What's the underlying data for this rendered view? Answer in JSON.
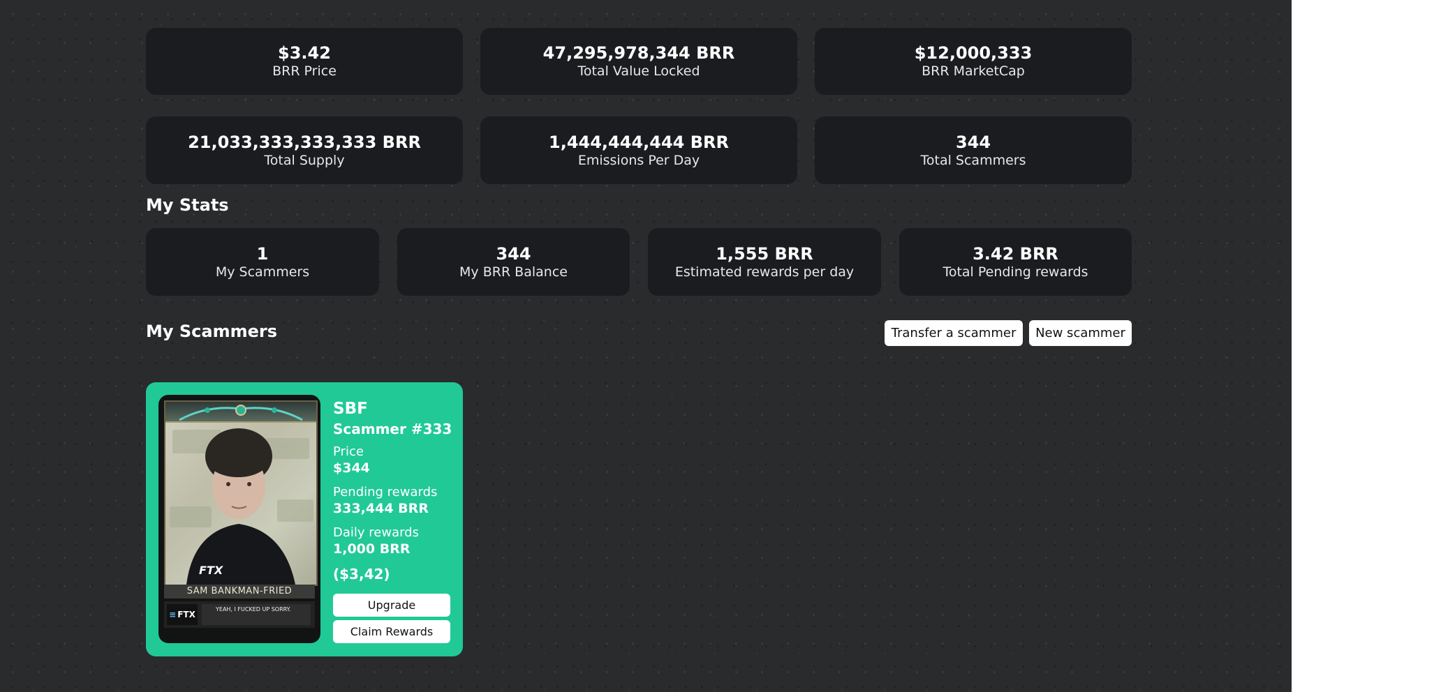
{
  "global_stats": [
    {
      "value": "$3.42",
      "label": "BRR Price"
    },
    {
      "value": "47,295,978,344 BRR",
      "label": "Total Value Locked"
    },
    {
      "value": "$12,000,333",
      "label": "BRR MarketCap"
    },
    {
      "value": "21,033,333,333,333 BRR",
      "label": "Total Supply"
    },
    {
      "value": "1,444,444,444 BRR",
      "label": "Emissions Per Day"
    },
    {
      "value": "344",
      "label": "Total Scammers"
    }
  ],
  "my_stats": {
    "title": "My Stats",
    "items": [
      {
        "value": "1",
        "label": "My Scammers"
      },
      {
        "value": "344",
        "label": "My BRR Balance"
      },
      {
        "value": "1,555 BRR",
        "label": "Estimated rewards per day"
      },
      {
        "value": "3.42 BRR",
        "label": "Total Pending rewards"
      }
    ]
  },
  "my_scammers": {
    "title": "My Scammers",
    "transfer_label": "Transfer a scammer",
    "new_label": "New scammer",
    "cards": [
      {
        "name": "SBF",
        "id_label": "Scammer #333",
        "price_label": "Price",
        "price": "$344",
        "pending_label": "Pending rewards",
        "pending": "333,444 BRR",
        "daily_label": "Daily rewards",
        "daily": "1,000 BRR",
        "daily_usd": "($3,42)",
        "upgrade_label": "Upgrade",
        "claim_label": "Claim Rewards",
        "portrait_name": "SAM BANKMAN-FRIED",
        "portrait_logo": "FTX",
        "portrait_shirt": "FTX",
        "portrait_quote": "YEAH, I FUCKED UP SORRY."
      }
    ]
  },
  "colors": {
    "background": "#2a2b2d",
    "card": "#1a1c1f",
    "accent": "#21c997"
  }
}
